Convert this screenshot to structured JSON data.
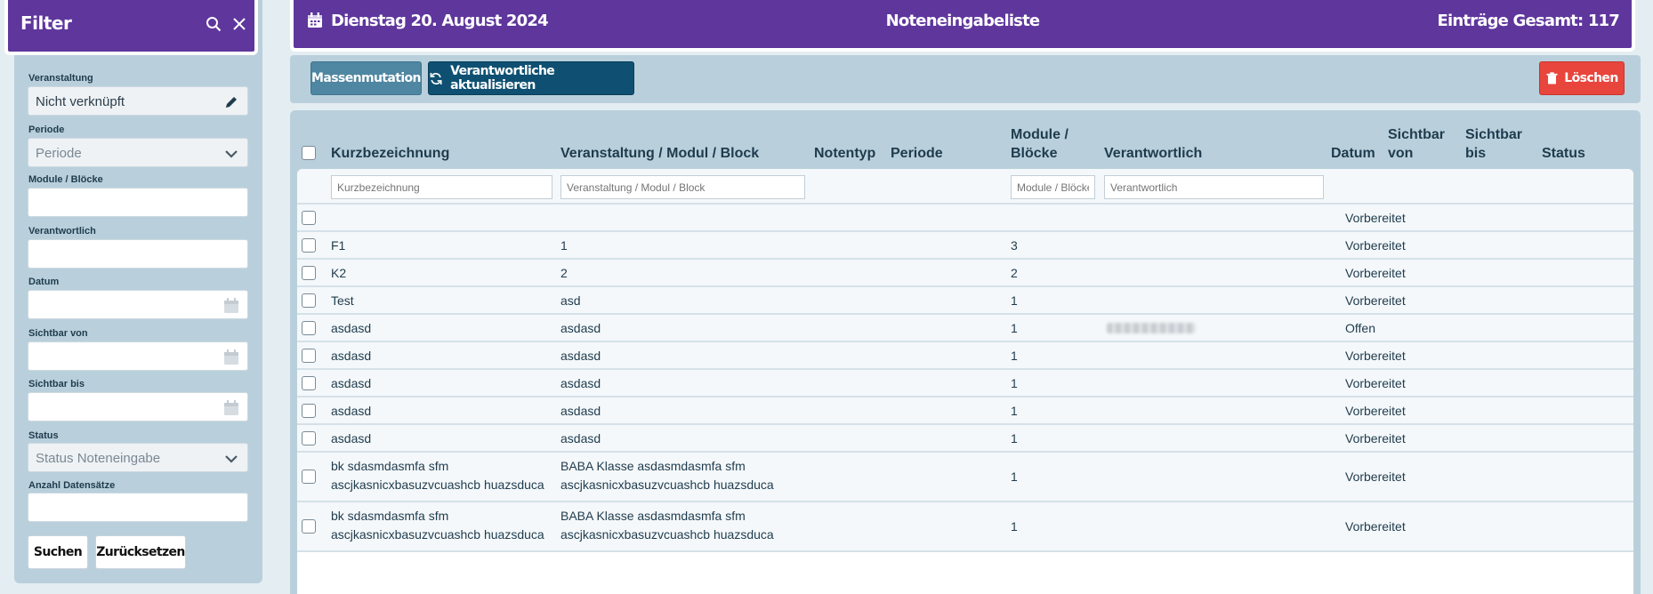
{
  "filter": {
    "title": "Filter",
    "fields": {
      "veranstaltung": {
        "label": "Veranstaltung",
        "value": "Nicht verknüpft"
      },
      "periode": {
        "label": "Periode",
        "placeholder": "Periode"
      },
      "module": {
        "label": "Module / Blöcke",
        "value": ""
      },
      "verantwortlich": {
        "label": "Verantwortlich",
        "value": ""
      },
      "datum": {
        "label": "Datum",
        "value": ""
      },
      "sichtbar_von": {
        "label": "Sichtbar von",
        "value": ""
      },
      "sichtbar_bis": {
        "label": "Sichtbar bis",
        "value": ""
      },
      "status": {
        "label": "Status",
        "placeholder": "Status Noteneingabe"
      },
      "anzahl": {
        "label": "Anzahl Datensätze",
        "value": ""
      }
    },
    "search_label": "Suchen",
    "reset_label": "Zurücksetzen"
  },
  "topbar": {
    "date": "Dienstag 20. August 2024",
    "title": "Noteneingabeliste",
    "count": "Einträge Gesamt: 117"
  },
  "actions": {
    "mass_label": "Massenmutation",
    "update_label": "Verantwortliche aktualisieren",
    "delete_label": "Löschen"
  },
  "table": {
    "headers": {
      "kurz": "Kurzbezeichnung",
      "veranst": "Veranstaltung / Modul / Block",
      "notentyp": "Notentyp",
      "periode": "Periode",
      "module_1": "Module /",
      "module_2": "Blöcke",
      "verantw": "Verantwortlich",
      "datum": "Datum",
      "svon_1": "Sichtbar",
      "svon_2": "von",
      "sbis_1": "Sichtbar",
      "sbis_2": "bis",
      "status": "Status"
    },
    "filters": {
      "kurz": "Kurzbezeichnung",
      "veranst": "Veranstaltung / Modul / Block",
      "module": "Module / Blöcke",
      "verantw": "Verantwortlich"
    },
    "rows": [
      {
        "kurz": "",
        "kurz2": "",
        "veranst": "",
        "veranst2": "",
        "module": "",
        "status": "Vorbereitet"
      },
      {
        "kurz": "F1",
        "kurz2": "",
        "veranst": "1",
        "veranst2": "",
        "module": "3",
        "status": "Vorbereitet"
      },
      {
        "kurz": "K2",
        "kurz2": "",
        "veranst": "2",
        "veranst2": "",
        "module": "2",
        "status": "Vorbereitet"
      },
      {
        "kurz": "Test",
        "kurz2": "",
        "veranst": "asd",
        "veranst2": "",
        "module": "1",
        "status": "Vorbereitet"
      },
      {
        "kurz": "asdasd",
        "kurz2": "",
        "veranst": "asdasd",
        "veranst2": "",
        "module": "1",
        "status": "Offen"
      },
      {
        "kurz": "asdasd",
        "kurz2": "",
        "veranst": "asdasd",
        "veranst2": "",
        "module": "1",
        "status": "Vorbereitet"
      },
      {
        "kurz": "asdasd",
        "kurz2": "",
        "veranst": "asdasd",
        "veranst2": "",
        "module": "1",
        "status": "Vorbereitet"
      },
      {
        "kurz": "asdasd",
        "kurz2": "",
        "veranst": "asdasd",
        "veranst2": "",
        "module": "1",
        "status": "Vorbereitet"
      },
      {
        "kurz": "asdasd",
        "kurz2": "",
        "veranst": "asdasd",
        "veranst2": "",
        "module": "1",
        "status": "Vorbereitet"
      },
      {
        "kurz": "bk sdasmdasmfa sfm",
        "kurz2": "ascjkasnicxbasuzvcuashcb huazsduca",
        "veranst": "BABA Klasse asdasmdasmfa sfm",
        "veranst2": "ascjkasnicxbasuzvcuashcb huazsduca",
        "module": "1",
        "status": "Vorbereitet"
      },
      {
        "kurz": "bk sdasmdasmfa sfm",
        "kurz2": "ascjkasnicxbasuzvcuashcb huazsduca",
        "veranst": "BABA Klasse asdasmdasmfa sfm",
        "veranst2": "ascjkasnicxbasuzvcuashcb huazsduca",
        "module": "1",
        "status": "Vorbereitet"
      }
    ]
  },
  "colors": {
    "purple": "#5e369c",
    "panel": "#b9d0dc",
    "mass_btn": "#4f86a1",
    "update_btn": "#0f5072",
    "delete_btn": "#e8453c"
  }
}
